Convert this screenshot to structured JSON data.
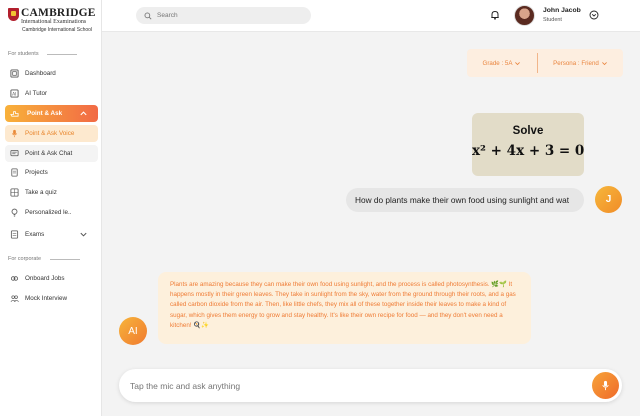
{
  "brand": {
    "line1": "CAMBRIDGE",
    "line2": "International Examinations",
    "line3": "Cambridge International School"
  },
  "sidebar": {
    "students_label": "For students",
    "corporate_label": "For corporate",
    "items": [
      {
        "label": "Dashboard",
        "icon": "dashboard-icon"
      },
      {
        "label": "AI Tutor",
        "icon": "ai-tutor-icon"
      },
      {
        "label": "Point & Ask",
        "icon": "hand-point-icon"
      },
      {
        "label": "Point & Ask Voice",
        "icon": "microphone-icon"
      },
      {
        "label": "Point & Ask Chat",
        "icon": "chat-icon"
      },
      {
        "label": "Projects",
        "icon": "document-icon"
      },
      {
        "label": "Take a quiz",
        "icon": "quiz-icon"
      },
      {
        "label": "Personalized le..",
        "icon": "bulb-icon"
      },
      {
        "label": "Exams",
        "icon": "exam-icon"
      },
      {
        "label": "Onboard Jobs",
        "icon": "link-icon"
      },
      {
        "label": "Mock Interview",
        "icon": "people-icon"
      }
    ]
  },
  "header": {
    "search_placeholder": "Search",
    "user_name": "John Jacob",
    "user_role": "Student"
  },
  "filters": {
    "grade": "Grade : 5A",
    "persona": "Persona : Friend"
  },
  "chat": {
    "problem_title": "Solve",
    "problem_equation": "x² + 4x + 3 = 0",
    "user_message": "How do plants make their own food using sunlight and wat",
    "user_initial": "J",
    "ai_initial": "AI",
    "ai_message": "Plants are amazing because they can make their own food using sunlight, and the process is called photosynthesis. 🌿🌱 It happens mostly in their green leaves. They take in sunlight from the sky, water from the ground through their roots, and a gas called carbon dioxide from the air. Then, like little chefs, they mix all of these together inside their leaves to make a kind of sugar, which gives them energy to grow and stay healthy. It's like their own recipe for food — and they don't even need a kitchen! 🍳✨"
  },
  "composer": {
    "placeholder": "Tap the mic and ask anything"
  },
  "colors": {
    "accent_start": "#f8b13a",
    "accent_end": "#f26a45",
    "ai_bubble": "#fdf0dc",
    "ai_text": "#ef7b34"
  }
}
